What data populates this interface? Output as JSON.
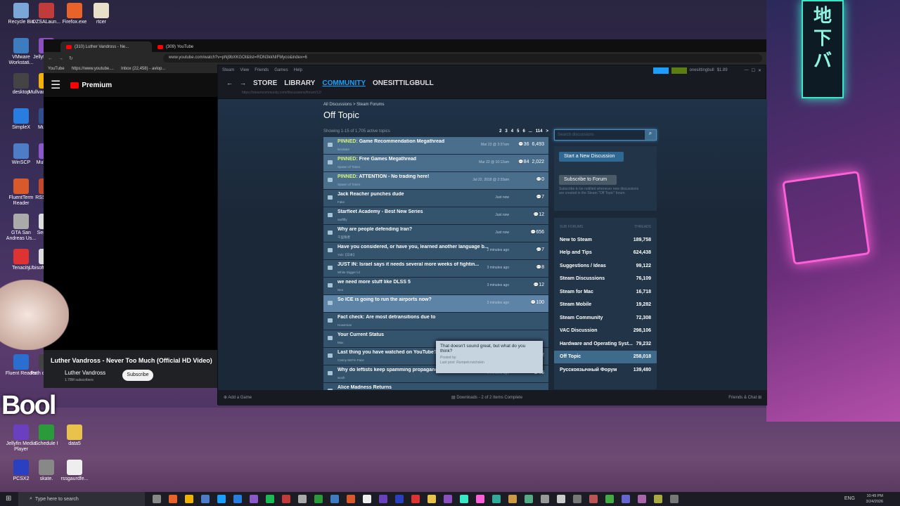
{
  "desktop": {
    "icons": [
      {
        "label": "Recycle Bin",
        "color": "#7aa7d8"
      },
      {
        "label": "DZSALaun...",
        "color": "#c23b3b"
      },
      {
        "label": "Firefox.exe",
        "color": "#e8622a"
      },
      {
        "label": "rtcer",
        "color": "#e8e0c8"
      },
      {
        "label": "VMware Workstati...",
        "color": "#3d7dbf"
      },
      {
        "label": "Jellyfin Se...",
        "color": "#8b4fbf"
      },
      {
        "label": "desktop",
        "color": "#444"
      },
      {
        "label": "Mullvad Brows...",
        "color": "#f0b400"
      },
      {
        "label": "SimpleX",
        "color": "#2a7de0"
      },
      {
        "label": "Mullvad",
        "color": "#2f4f8f"
      },
      {
        "label": "WinSCP",
        "color": "#4c7dc6"
      },
      {
        "label": "Multi-M...",
        "color": "#8a58c8"
      },
      {
        "label": "FluentTerm Reader",
        "color": "#d85a2a"
      },
      {
        "label": "RSS Gu...",
        "color": "#c24a2a"
      },
      {
        "label": "GTA San Andreas Us...",
        "color": "#aaa"
      },
      {
        "label": "Sessio...",
        "color": "#ddd"
      },
      {
        "label": "Tenacity",
        "color": "#d33"
      },
      {
        "label": "Ubisoft Connect",
        "color": "#ddd"
      },
      {
        "label": "Fluent Reader",
        "color": "#2a6ed0"
      },
      {
        "label": "Path of Exile 2",
        "color": "#444"
      },
      {
        "label": "Jellyfin Media Player",
        "color": "#6a3fc0"
      },
      {
        "label": "Schedule I",
        "color": "#2a9a3a"
      },
      {
        "label": "data5",
        "color": "#e8c24a"
      },
      {
        "label": "PCSX2",
        "color": "#2a40c0"
      },
      {
        "label": "skate.",
        "color": "#888"
      },
      {
        "label": "rssgaurdfe...",
        "color": "#eee"
      }
    ],
    "overlay_text": "Bool"
  },
  "browser": {
    "tabs": [
      {
        "label": "(310) Luther Vandross - Ne..."
      },
      {
        "label": "(309) YouTube"
      }
    ],
    "url": "www.youtube.com/watch?v=pNj9bXKGOI&list=RDN3kkNIFMyco&index=6",
    "bookmarks": [
      "YouTube",
      "https://www.youtube....",
      "Inbox (22,458) - avlop..."
    ],
    "yt": {
      "logo": "Premium",
      "video_title": "Luther Vandross - Never Too Much (Official HD Video)",
      "channel": "Luther Vandross",
      "subscribers": "1.78M subscribers",
      "subscribe": "Subscribe"
    }
  },
  "steam": {
    "menu": [
      "Steam",
      "View",
      "Friends",
      "Games",
      "Help"
    ],
    "account": "onesittingbull",
    "balance": "$1.89",
    "nav": {
      "store": "STORE",
      "library": "LIBRARY",
      "community": "COMMUNITY",
      "user": "ONESITTILGBULL"
    },
    "url": "https://steamcommunity.com/discussions/forum/12/",
    "breadcrumb": "All Discussions > Steam Forums",
    "forum_title": "Off Topic",
    "showing": "Showing 1-15 of 1,705 active topics",
    "pages": [
      "2",
      "3",
      "4",
      "5",
      "6",
      "...",
      "114",
      ">"
    ],
    "topics": [
      {
        "prefix": "PINNED: ",
        "title": "Game Recommendation Megathread",
        "author": "lanokate",
        "time": "Mar 23 @ 3:37am",
        "replies": "36",
        "views": "6,493",
        "pinned": true
      },
      {
        "prefix": "PINNED: ",
        "title": "Free Games Megathread",
        "author": "Spawn of Totoro",
        "time": "Mar 22 @ 10:12am",
        "replies": "84",
        "views": "2,022",
        "pinned": true
      },
      {
        "prefix": "PINNED: ",
        "title": "ATTENTION - No trading here!",
        "author": "Spawn of Totoro",
        "time": "Jul 22, 2018 @ 2:33am",
        "replies": "0",
        "views": "",
        "pinned": true
      },
      {
        "prefix": "",
        "title": "Jack Reacher punches dude",
        "author": "Fake",
        "time": "Just now",
        "replies": "7",
        "views": ""
      },
      {
        "prefix": "",
        "title": "Starfleet Academy - Best New Series",
        "author": "swiftfly",
        "time": "Just now",
        "replies": "12",
        "views": ""
      },
      {
        "prefix": "",
        "title": "Why are people defending Iran?",
        "author": "千里眼者",
        "time": "Just now",
        "replies": "656",
        "views": ""
      },
      {
        "prefix": "",
        "title": "Have you considered, or have you, learned another language b...",
        "author": "Yuki【日本】",
        "time": "2 minutes ago",
        "replies": "7",
        "views": ""
      },
      {
        "prefix": "",
        "title": "JUST IN: Israel says it needs several more weeks of fightin...",
        "author": "White Digger lol",
        "time": "3 minutes ago",
        "replies": "8",
        "views": ""
      },
      {
        "prefix": "",
        "title": "we need more stuff like DLSS 5",
        "author": "Neo",
        "time": "3 minutes ago",
        "replies": "12",
        "views": ""
      },
      {
        "prefix": "",
        "title": "So ICE is going to run the airports now?",
        "author": "",
        "time": "3 minutes ago",
        "replies": "100",
        "views": "",
        "hover": true
      },
      {
        "prefix": "",
        "title": "Fact check: Are most detransitions due to",
        "author": "Howeman",
        "time": "",
        "replies": "",
        "views": ""
      },
      {
        "prefix": "",
        "title": "Your Current Status",
        "author": "Max",
        "time": "",
        "replies": "",
        "views": ""
      },
      {
        "prefix": "",
        "title": "Last thing you have watched on YouTube?",
        "author": "Canny McFin Face",
        "time": "6 minutes ago",
        "replies": "47",
        "views": "57,712"
      },
      {
        "prefix": "",
        "title": "Why do leftists keep spamming propaganda here using mu...",
        "author": "woxh",
        "time": "9 minutes ago",
        "replies": "65",
        "views": ""
      },
      {
        "prefix": "",
        "title": "Alice Madness Returns",
        "author": "",
        "time": "",
        "replies": "",
        "views": ""
      }
    ],
    "tooltip": {
      "text": "That doesn't sound great, but what do you think?",
      "posted": "Posted by:",
      "last": "Last post: Rumpelcrutchskin"
    },
    "search_placeholder": "Search discussions",
    "start_btn": "Start a New Discussion",
    "subscribe_btn": "Subscribe to Forum",
    "subscribe_note": "Subscribe to be notified whenever new discussions are created in the Steam \"Off Topic\" forum.",
    "subforums_head": "SUB FORUMS",
    "threads_head": "THREADS",
    "subforums": [
      {
        "name": "New to Steam",
        "count": "189,758"
      },
      {
        "name": "Help and Tips",
        "count": "624,438"
      },
      {
        "name": "Suggestions / Ideas",
        "count": "99,122"
      },
      {
        "name": "Steam Discussions",
        "count": "76,109"
      },
      {
        "name": "Steam for Mac",
        "count": "16,718"
      },
      {
        "name": "Steam Mobile",
        "count": "19,282"
      },
      {
        "name": "Steam Community",
        "count": "72,308"
      },
      {
        "name": "VAC Discussion",
        "count": "298,106"
      },
      {
        "name": "Hardware and Operating Syst...",
        "count": "79,232"
      },
      {
        "name": "Off Topic",
        "count": "258,018",
        "selected": true
      },
      {
        "name": "Русскоязычный Форум",
        "count": "139,480"
      }
    ],
    "footer": {
      "add_game": "Add a Game",
      "downloads": "Downloads - 2 of 2 Items Complete",
      "friends": "Friends & Chat"
    }
  },
  "taskbar": {
    "search": "Type here to search",
    "lang": "ENG",
    "time": "10:49 PM",
    "date": "3/24/2026"
  }
}
